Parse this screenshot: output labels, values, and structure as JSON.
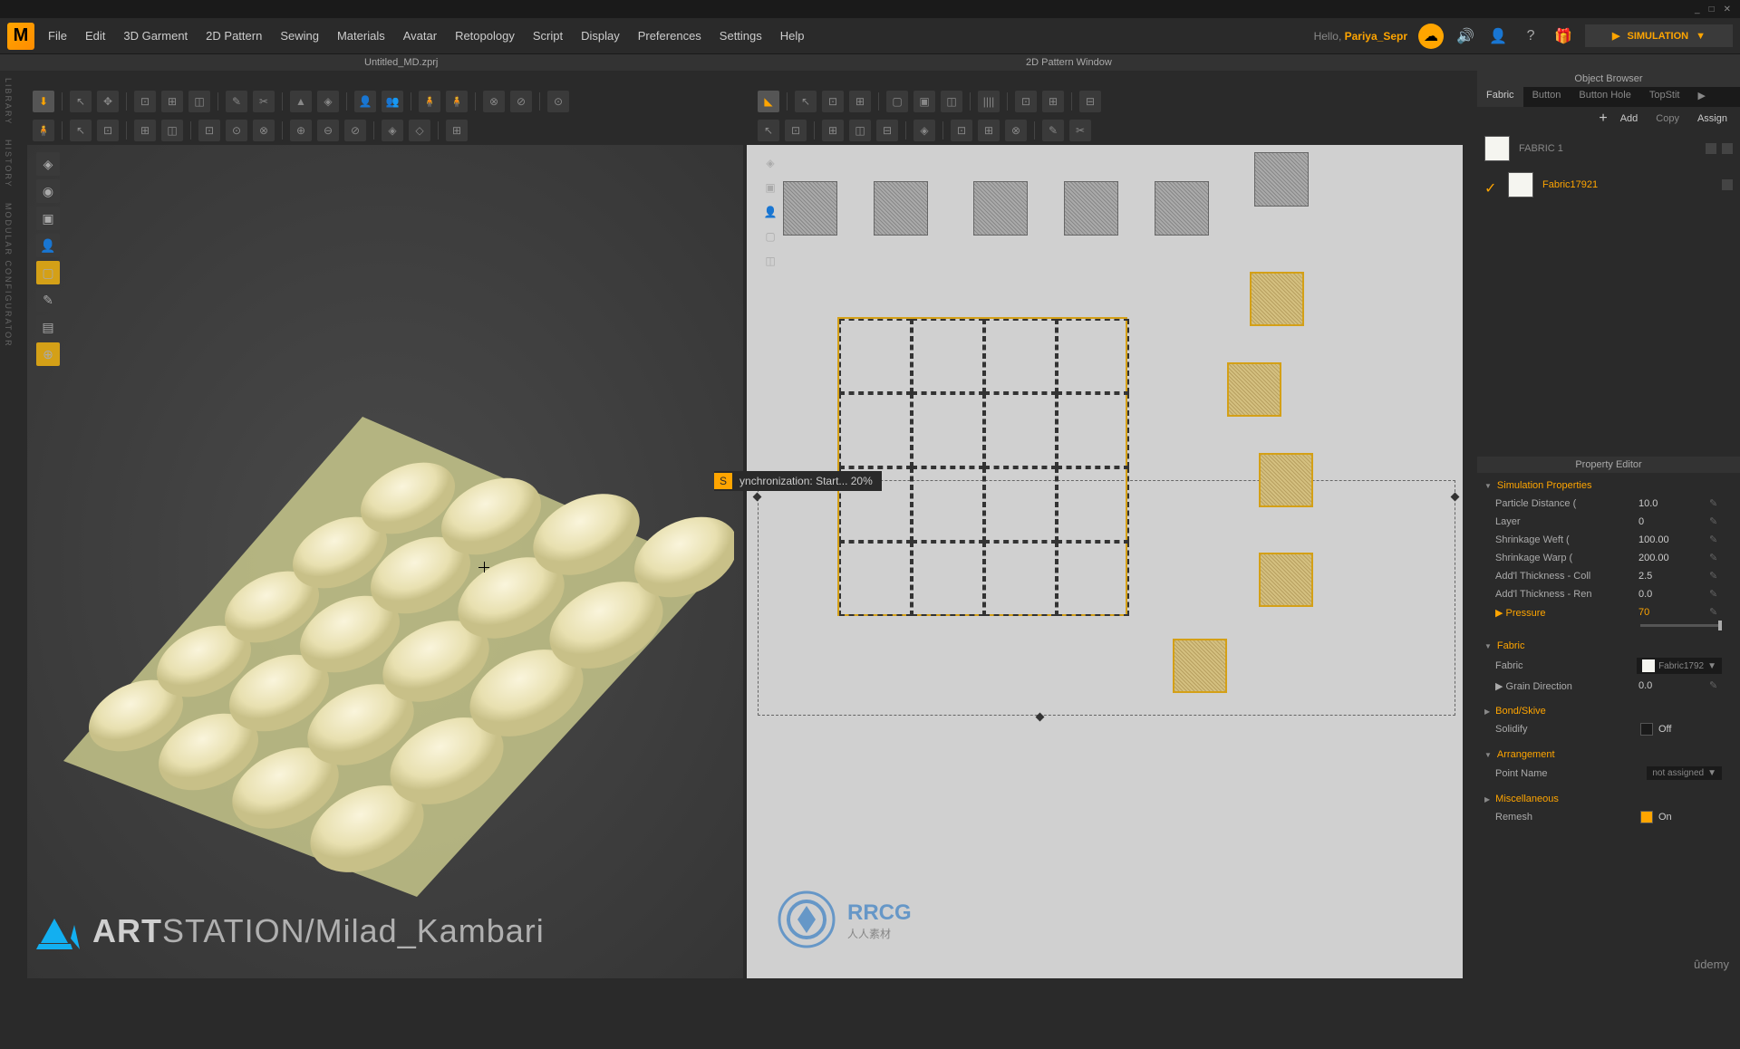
{
  "titleBar": {
    "min": "_",
    "max": "□",
    "close": "✕"
  },
  "menu": {
    "items": [
      "File",
      "Edit",
      "3D Garment",
      "2D Pattern",
      "Sewing",
      "Materials",
      "Avatar",
      "Retopology",
      "Script",
      "Display",
      "Preferences",
      "Settings",
      "Help"
    ],
    "greeting": "Hello,",
    "username": "Pariya_Sepr",
    "simButton": "SIMULATION"
  },
  "fileTabs": {
    "left": "Untitled_MD.zprj",
    "right": "2D Pattern Window"
  },
  "syncTooltip": "ynchronization: Start... 20%",
  "rightPanel": {
    "objectBrowser": "Object Browser",
    "tabs": [
      "Fabric",
      "Button",
      "Button Hole",
      "TopStit"
    ],
    "buttons": {
      "add": "Add",
      "copy": "Copy",
      "assign": "Assign"
    },
    "fabrics": [
      {
        "name": "FABRIC 1",
        "active": false
      },
      {
        "name": "Fabric17921",
        "active": true
      }
    ],
    "propertyEditor": "Property Editor",
    "sections": {
      "simProps": {
        "title": "Simulation Properties",
        "rows": [
          {
            "label": "Particle Distance (",
            "value": "10.0"
          },
          {
            "label": "Layer",
            "value": "0"
          },
          {
            "label": "Shrinkage Weft (",
            "value": "100.00"
          },
          {
            "label": "Shrinkage Warp (",
            "value": "200.00"
          },
          {
            "label": "Add'l Thickness - Coll",
            "value": "2.5"
          },
          {
            "label": "Add'l Thickness - Ren",
            "value": "0.0"
          }
        ],
        "pressure": {
          "label": "Pressure",
          "value": "70"
        }
      },
      "fabric": {
        "title": "Fabric",
        "fabricLabel": "Fabric",
        "fabricValue": "Fabric1792",
        "grainLabel": "Grain Direction",
        "grainValue": "0.0"
      },
      "bondSkive": {
        "title": "Bond/Skive",
        "solidifyLabel": "Solidify",
        "solidifyValue": "Off"
      },
      "arrangement": {
        "title": "Arrangement",
        "pointLabel": "Point Name",
        "pointValue": "not assigned"
      },
      "misc": {
        "title": "Miscellaneous",
        "remeshLabel": "Remesh",
        "remeshValue": "On"
      }
    }
  },
  "watermark": {
    "prefix": "ART",
    "main": "STATION",
    "suffix": "/Milad_Kambari",
    "rrcg": "RRCG",
    "udemy": "ûdemy"
  },
  "leftSidebar": [
    "LIBRARY",
    "HISTORY",
    "MODULAR CONFIGURATOR"
  ]
}
